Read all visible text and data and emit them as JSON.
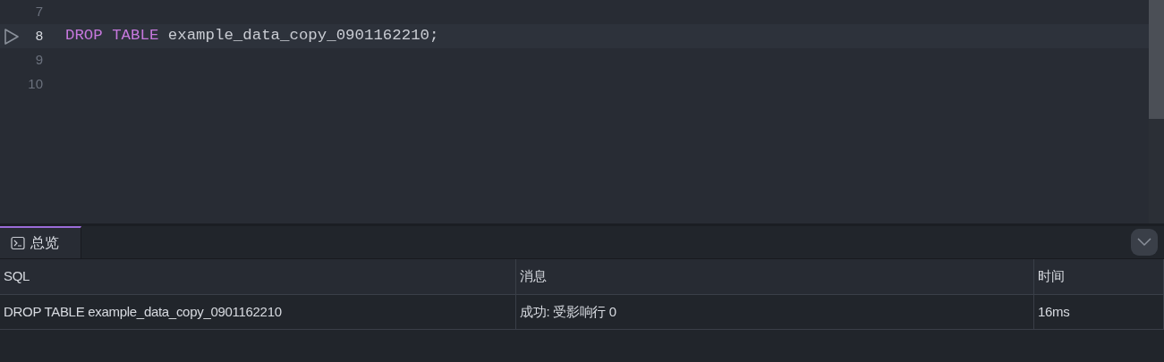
{
  "editor": {
    "lines": [
      {
        "number": "7",
        "active": false
      },
      {
        "number": "8",
        "active": true,
        "tokens": [
          {
            "text": "DROP",
            "kind": "keyword"
          },
          {
            "text": " TABLE",
            "kind": "keyword"
          },
          {
            "text": " example_data_copy_0901162210;",
            "kind": "plain"
          }
        ]
      },
      {
        "number": "9",
        "active": false
      },
      {
        "number": "10",
        "active": false
      }
    ]
  },
  "results": {
    "tabs": [
      {
        "label": "总览",
        "selected": true
      }
    ],
    "table": {
      "columns": [
        "SQL",
        "消息",
        "时间"
      ],
      "rows": [
        [
          "DROP TABLE example_data_copy_0901162210",
          "成功: 受影响行 0",
          "16ms"
        ]
      ]
    }
  }
}
